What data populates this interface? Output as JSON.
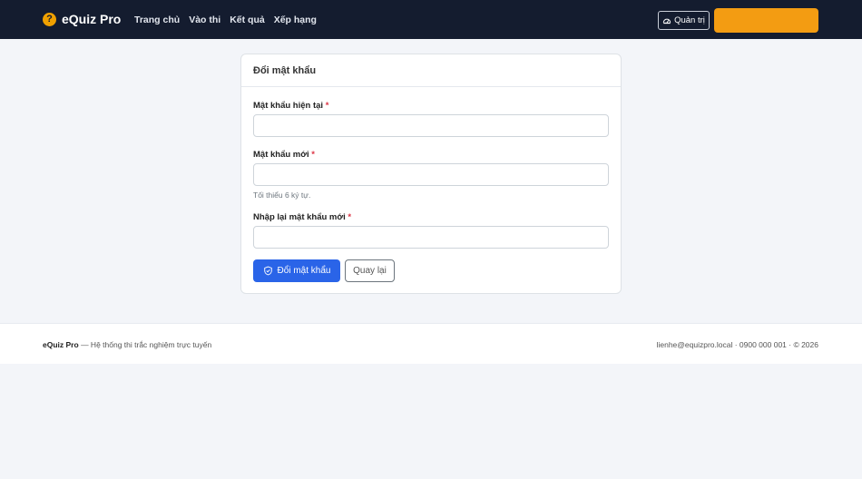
{
  "navbar": {
    "brand": "eQuiz Pro",
    "brand_icon": "question-circle-icon",
    "links": [
      "Trang chủ",
      "Vào thi",
      "Kết quả",
      "Xếp hạng"
    ],
    "admin_label": "Quản trị"
  },
  "form": {
    "title": "Đổi mật khẩu",
    "current_label": "Mật khẩu hiện tại",
    "new_label": "Mật khẩu mới",
    "new_hint": "Tối thiểu 6 ký tự.",
    "confirm_label": "Nhập lại mật khẩu mới",
    "required_mark": "*",
    "submit_label": "Đổi mật khẩu",
    "back_label": "Quay lại"
  },
  "footer": {
    "brand": "eQuiz Pro",
    "tagline": "— Hệ thống thi trắc nghiệm trực tuyến",
    "contact": "lienhe@equizpro.local · 0900 000 001 · © 2026"
  },
  "colors": {
    "navbar": "#141c2f",
    "primary": "#2a64e8",
    "accent": "#f39c12"
  }
}
